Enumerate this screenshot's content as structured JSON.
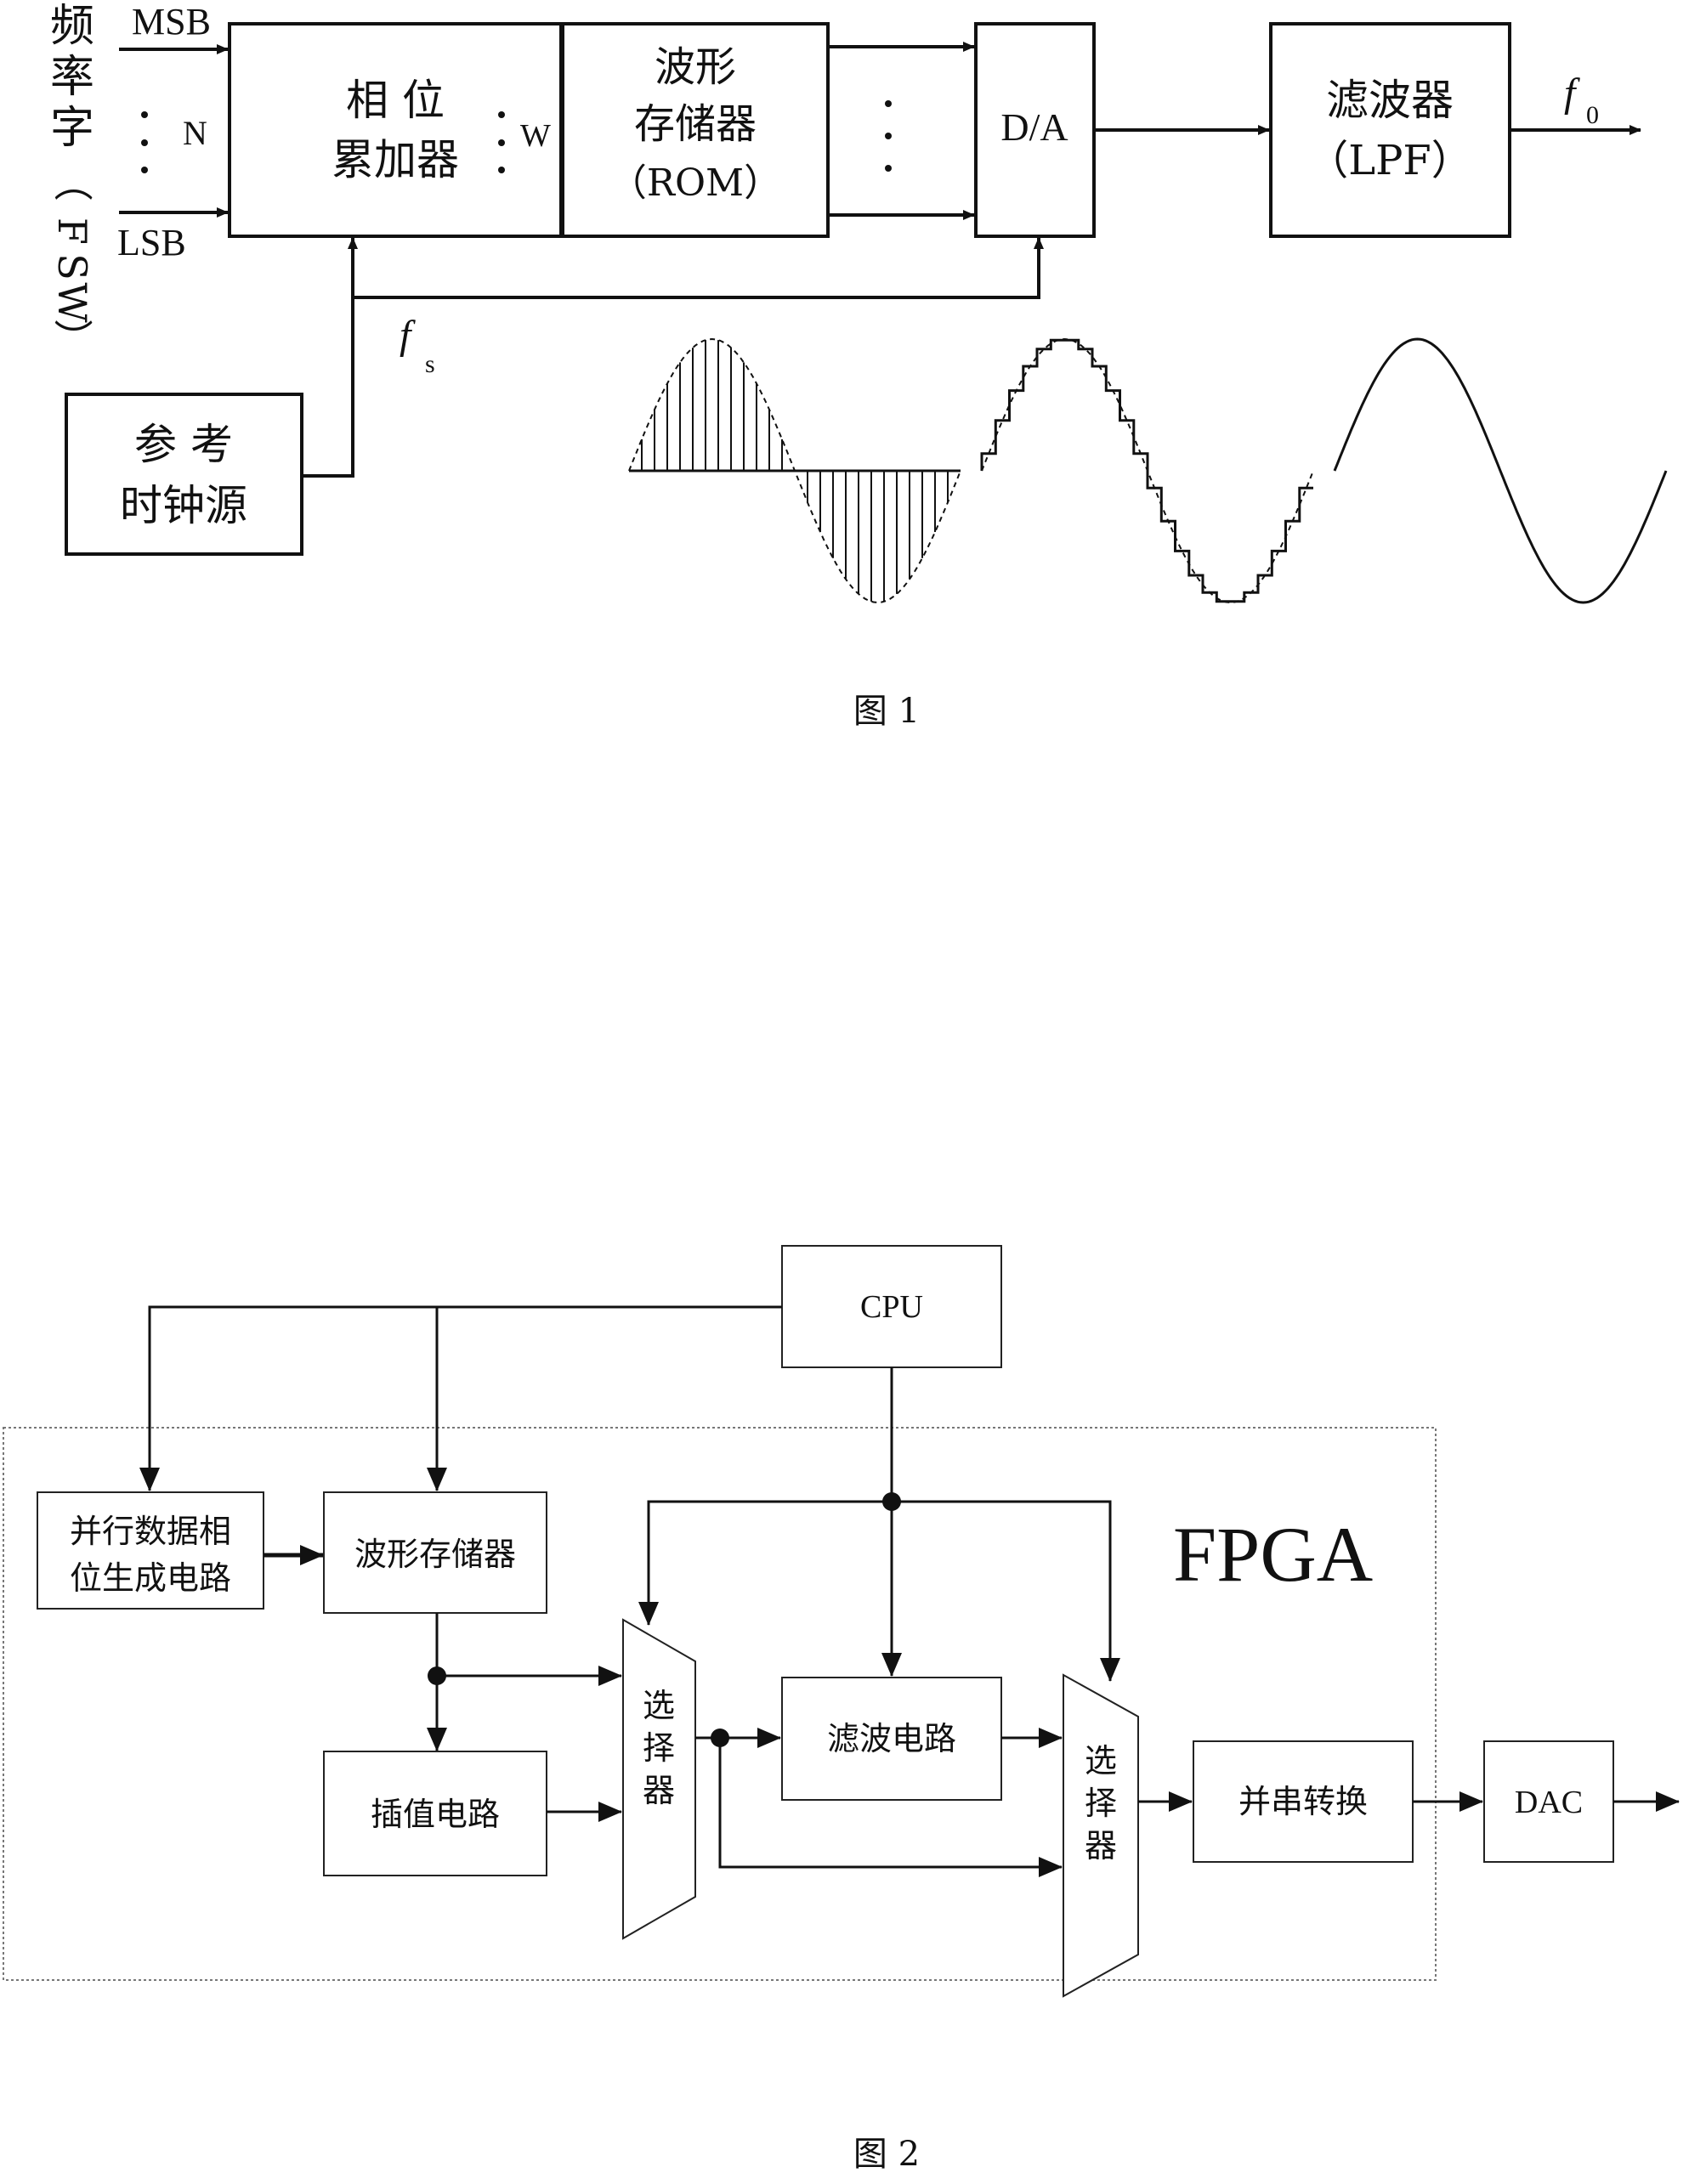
{
  "figure1": {
    "input_label": "频率字（FSW）",
    "msb": "MSB",
    "lsb": "LSB",
    "n": "N",
    "w": "W",
    "accumulator": [
      "相 位",
      "累加器"
    ],
    "rom": [
      "波形",
      "存储器",
      "（ROM）"
    ],
    "dac": "D/A",
    "filter": [
      "滤波器",
      "（LPF）"
    ],
    "output": "f",
    "output_sub": "0",
    "clock_freq": "f",
    "clock_freq_sub": "s",
    "clock": [
      "参 考",
      "时钟源"
    ],
    "caption": "图 1"
  },
  "figure2": {
    "cpu": "CPU",
    "fpga": "FPGA",
    "phase_gen": [
      "并行数据相",
      "位生成电路"
    ],
    "rom": "波形存储器",
    "interp": "插值电路",
    "filter": "滤波电路",
    "selector1": [
      "选",
      "择",
      "器"
    ],
    "selector2": [
      "选",
      "择",
      "器"
    ],
    "ps_conv": "并串转换",
    "dac": "DAC",
    "caption": "图 2"
  }
}
